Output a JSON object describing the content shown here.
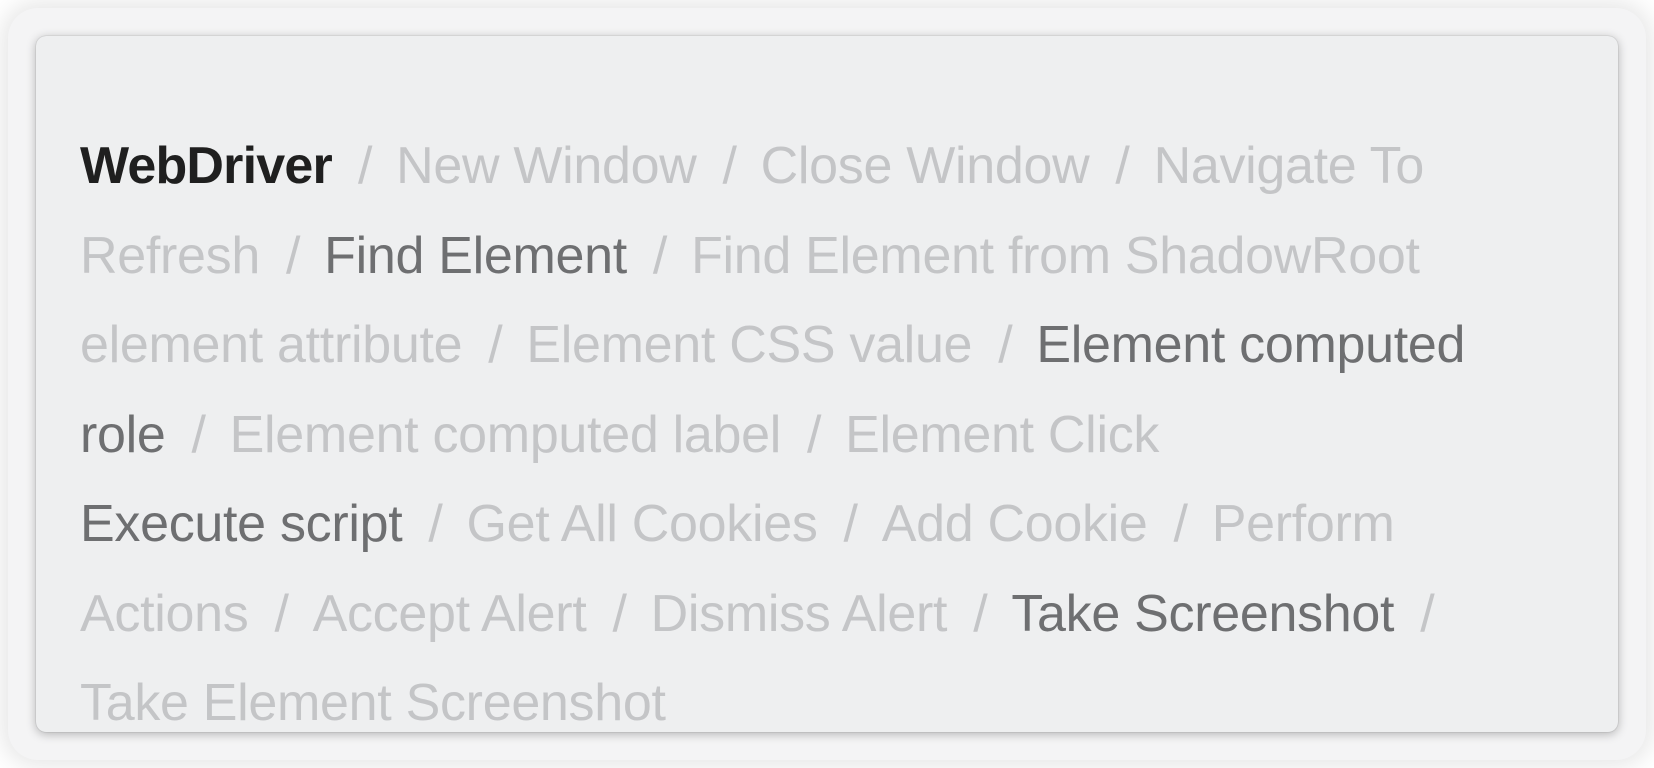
{
  "colors": {
    "title": "#1f1f1f",
    "active": "#6e6f71",
    "muted": "#c4c5c7",
    "card_background": "#eeeff0"
  },
  "separator": "/",
  "items": [
    {
      "label": "WebDriver",
      "state": "title"
    },
    {
      "label": "New Window",
      "state": "muted"
    },
    {
      "label": "Close Window",
      "state": "muted"
    },
    {
      "label": "Navigate To",
      "state": "muted"
    },
    {
      "label": "Refresh",
      "state": "muted"
    },
    {
      "label": "Find Element",
      "state": "active"
    },
    {
      "label": "Find Element from ShadowRoot",
      "state": "muted"
    },
    {
      "label": "element attribute",
      "state": "muted"
    },
    {
      "label": "Element CSS value",
      "state": "muted"
    },
    {
      "label": "Element computed role",
      "state": "active"
    },
    {
      "label": "Element computed label",
      "state": "muted"
    },
    {
      "label": "Element Click",
      "state": "muted"
    },
    {
      "label": "Execute script",
      "state": "active"
    },
    {
      "label": "Get All Cookies",
      "state": "muted"
    },
    {
      "label": "Add Cookie",
      "state": "muted"
    },
    {
      "label": "Perform Actions",
      "state": "muted"
    },
    {
      "label": "Accept Alert",
      "state": "muted"
    },
    {
      "label": "Dismiss Alert",
      "state": "muted"
    },
    {
      "label": "Take Screenshot",
      "state": "active"
    },
    {
      "label": "Take Element Screenshot",
      "state": "muted"
    }
  ]
}
